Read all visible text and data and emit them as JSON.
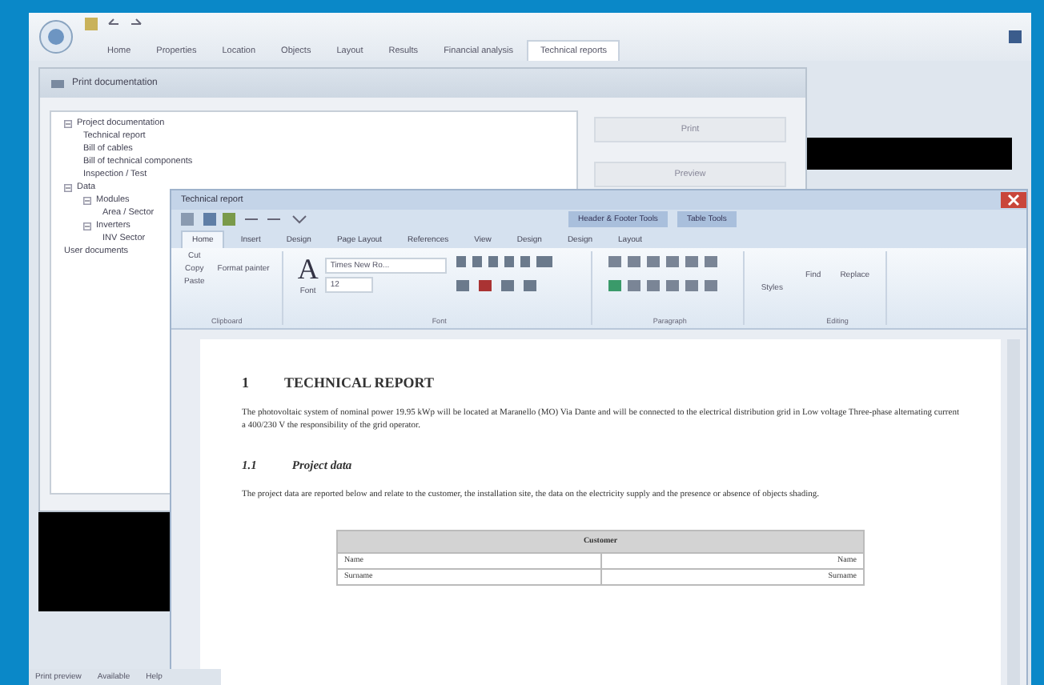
{
  "app": {
    "tabs": [
      {
        "label": "Home",
        "selected": false
      },
      {
        "label": "Properties",
        "selected": false
      },
      {
        "label": "Location",
        "selected": false
      },
      {
        "label": "Objects",
        "selected": false
      },
      {
        "label": "Layout",
        "selected": false
      },
      {
        "label": "Results",
        "selected": false
      },
      {
        "label": "Financial analysis",
        "selected": false
      },
      {
        "label": "Technical reports",
        "selected": true
      }
    ],
    "status_bar": [
      "Print preview",
      "Available",
      "Help"
    ]
  },
  "print_dialog": {
    "title": "Print documentation",
    "tree": [
      {
        "label": "Project documentation",
        "expanded": true,
        "children": [
          {
            "label": "Technical report"
          },
          {
            "label": "Bill of cables"
          },
          {
            "label": "Bill of technical components"
          },
          {
            "label": "Inspection / Test"
          }
        ]
      },
      {
        "label": "Data",
        "expanded": true,
        "children": [
          {
            "label": "Modules",
            "expanded": true,
            "children": [
              {
                "label": "Area / Sector"
              }
            ]
          },
          {
            "label": "Inverters",
            "expanded": true,
            "children": [
              {
                "label": "INV Sector"
              }
            ]
          }
        ]
      },
      {
        "label": "User documents"
      }
    ],
    "buttons": [
      "Print",
      "Preview"
    ]
  },
  "word": {
    "title": "Technical report",
    "context_tabs": [
      "Header & Footer Tools",
      "Table Tools"
    ],
    "tabs": [
      {
        "label": "Home",
        "selected": true
      },
      {
        "label": "Insert",
        "selected": false
      },
      {
        "label": "Design",
        "selected": false
      },
      {
        "label": "Page Layout",
        "selected": false
      },
      {
        "label": "References",
        "selected": false
      },
      {
        "label": "View",
        "selected": false
      },
      {
        "label": "Design",
        "selected": false
      },
      {
        "label": "Design",
        "selected": false
      },
      {
        "label": "Layout",
        "selected": false
      }
    ],
    "clipboard": [
      "Cut",
      "Copy",
      "Paste"
    ],
    "format_painter": "Format painter",
    "font_glyph": "A",
    "font_label": "Font",
    "font_name": "Times New Ro...",
    "font_size": "12",
    "style_button": "Styles",
    "find_buttons": [
      "Find",
      "Replace"
    ],
    "group_labels": [
      "Clipboard",
      "Font",
      "Paragraph",
      "Editing"
    ],
    "document": {
      "heading_number": "1",
      "heading": "TECHNICAL REPORT",
      "paragraph": "The photovoltaic system of nominal power 19.95 kWp will be located at Maranello (MO) Via Dante and will be connected to the electrical distribution grid in Low voltage Three-phase alternating current a 400/230 V the responsibility of the grid operator.",
      "subheading_number": "1.1",
      "subheading": "Project data",
      "paragraph_2": "The project data are reported below and relate to the customer, the installation site, the data on the electricity supply and the presence or absence of objects shading.",
      "table": {
        "title": "Customer",
        "rows": [
          [
            "Name",
            "Name"
          ],
          [
            "Surname",
            "Surname"
          ]
        ]
      }
    }
  }
}
